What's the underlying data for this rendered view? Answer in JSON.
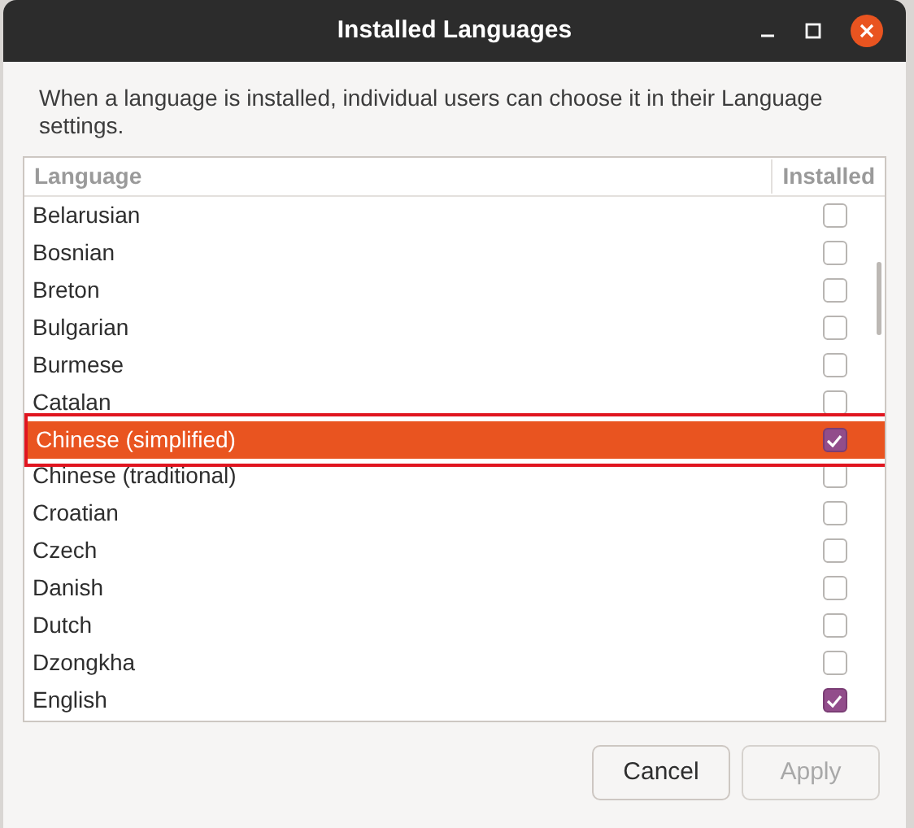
{
  "window": {
    "title": "Installed Languages"
  },
  "description": "When a language is installed, individual users can choose it in their Language settings.",
  "table": {
    "columns": [
      "Language",
      "Installed"
    ],
    "rows": [
      {
        "language": "Belarusian",
        "installed": false,
        "selected": false
      },
      {
        "language": "Bosnian",
        "installed": false,
        "selected": false
      },
      {
        "language": "Breton",
        "installed": false,
        "selected": false
      },
      {
        "language": "Bulgarian",
        "installed": false,
        "selected": false
      },
      {
        "language": "Burmese",
        "installed": false,
        "selected": false
      },
      {
        "language": "Catalan",
        "installed": false,
        "selected": false
      },
      {
        "language": "Chinese (simplified)",
        "installed": true,
        "selected": true
      },
      {
        "language": "Chinese (traditional)",
        "installed": false,
        "selected": false
      },
      {
        "language": "Croatian",
        "installed": false,
        "selected": false
      },
      {
        "language": "Czech",
        "installed": false,
        "selected": false
      },
      {
        "language": "Danish",
        "installed": false,
        "selected": false
      },
      {
        "language": "Dutch",
        "installed": false,
        "selected": false
      },
      {
        "language": "Dzongkha",
        "installed": false,
        "selected": false
      },
      {
        "language": "English",
        "installed": true,
        "selected": false
      }
    ]
  },
  "buttons": [
    {
      "label": "Cancel",
      "disabled": false
    },
    {
      "label": "Apply",
      "disabled": true
    }
  ]
}
